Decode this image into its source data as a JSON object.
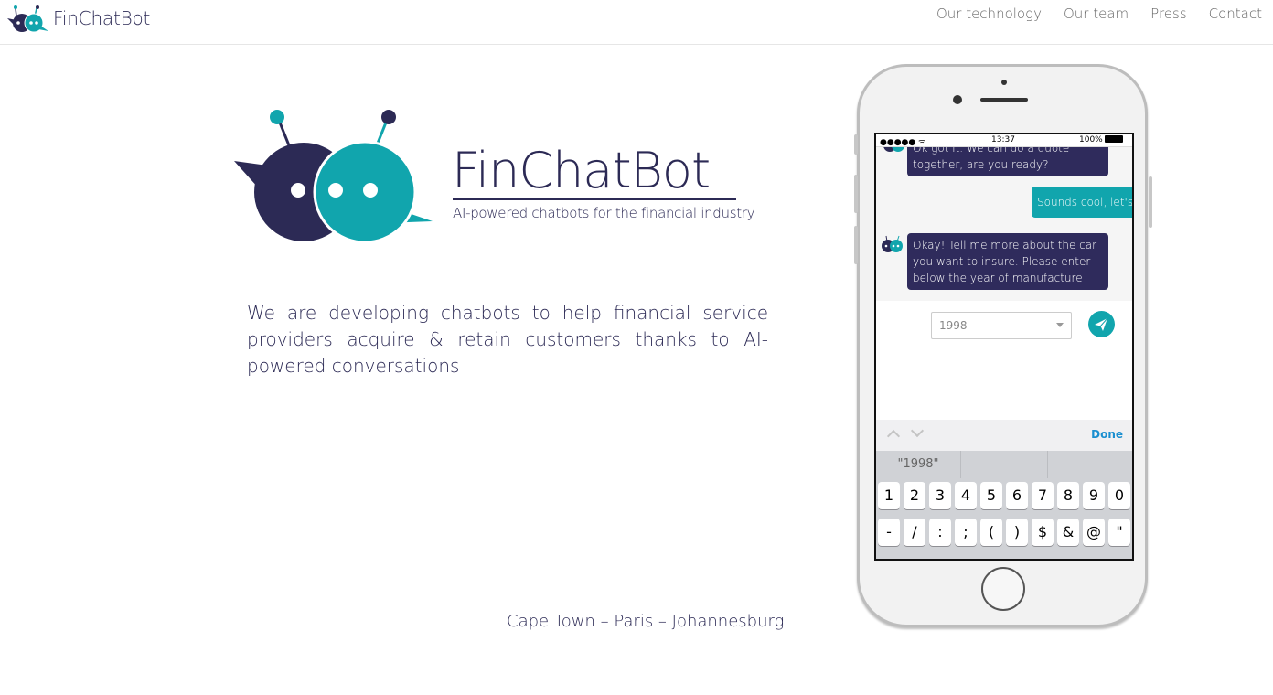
{
  "navbar": {
    "brand": "FinChatBot",
    "links": [
      "Our technology",
      "Our team",
      "Press",
      "Contact"
    ]
  },
  "hero": {
    "title": "FinChatBot",
    "tagline": "AI-powered chatbots for the financial industry",
    "intro": "We are developing chatbots to help financial service providers acquire & retain customers thanks to AI-powered conversations",
    "cities": "Cape Town – Paris – Johannesburg"
  },
  "colors": {
    "brand_navy": "#2c2a55",
    "brand_teal": "#11a5ad",
    "link_gray": "#666666"
  },
  "phone": {
    "status": {
      "signal": "●●●●● ᯤ",
      "time": "13:37",
      "battery": "100%"
    },
    "messages": [
      {
        "from": "bot",
        "text": "Ok got it. We can do a quote together, are you ready?"
      },
      {
        "from": "user",
        "text": "Sounds cool, let's do it"
      },
      {
        "from": "bot",
        "text": "Okay! Tell me more about the car you want to insure. Please enter below the year of manufacture"
      }
    ],
    "year_select_value": "1998",
    "keyboard": {
      "done_label": "Done",
      "suggestion": "\"1998\"",
      "row1": [
        "1",
        "2",
        "3",
        "4",
        "5",
        "6",
        "7",
        "8",
        "9",
        "0"
      ],
      "row2": [
        "-",
        "/",
        ":",
        ";",
        "(",
        ")",
        "$",
        "&",
        "@",
        "\""
      ]
    }
  }
}
